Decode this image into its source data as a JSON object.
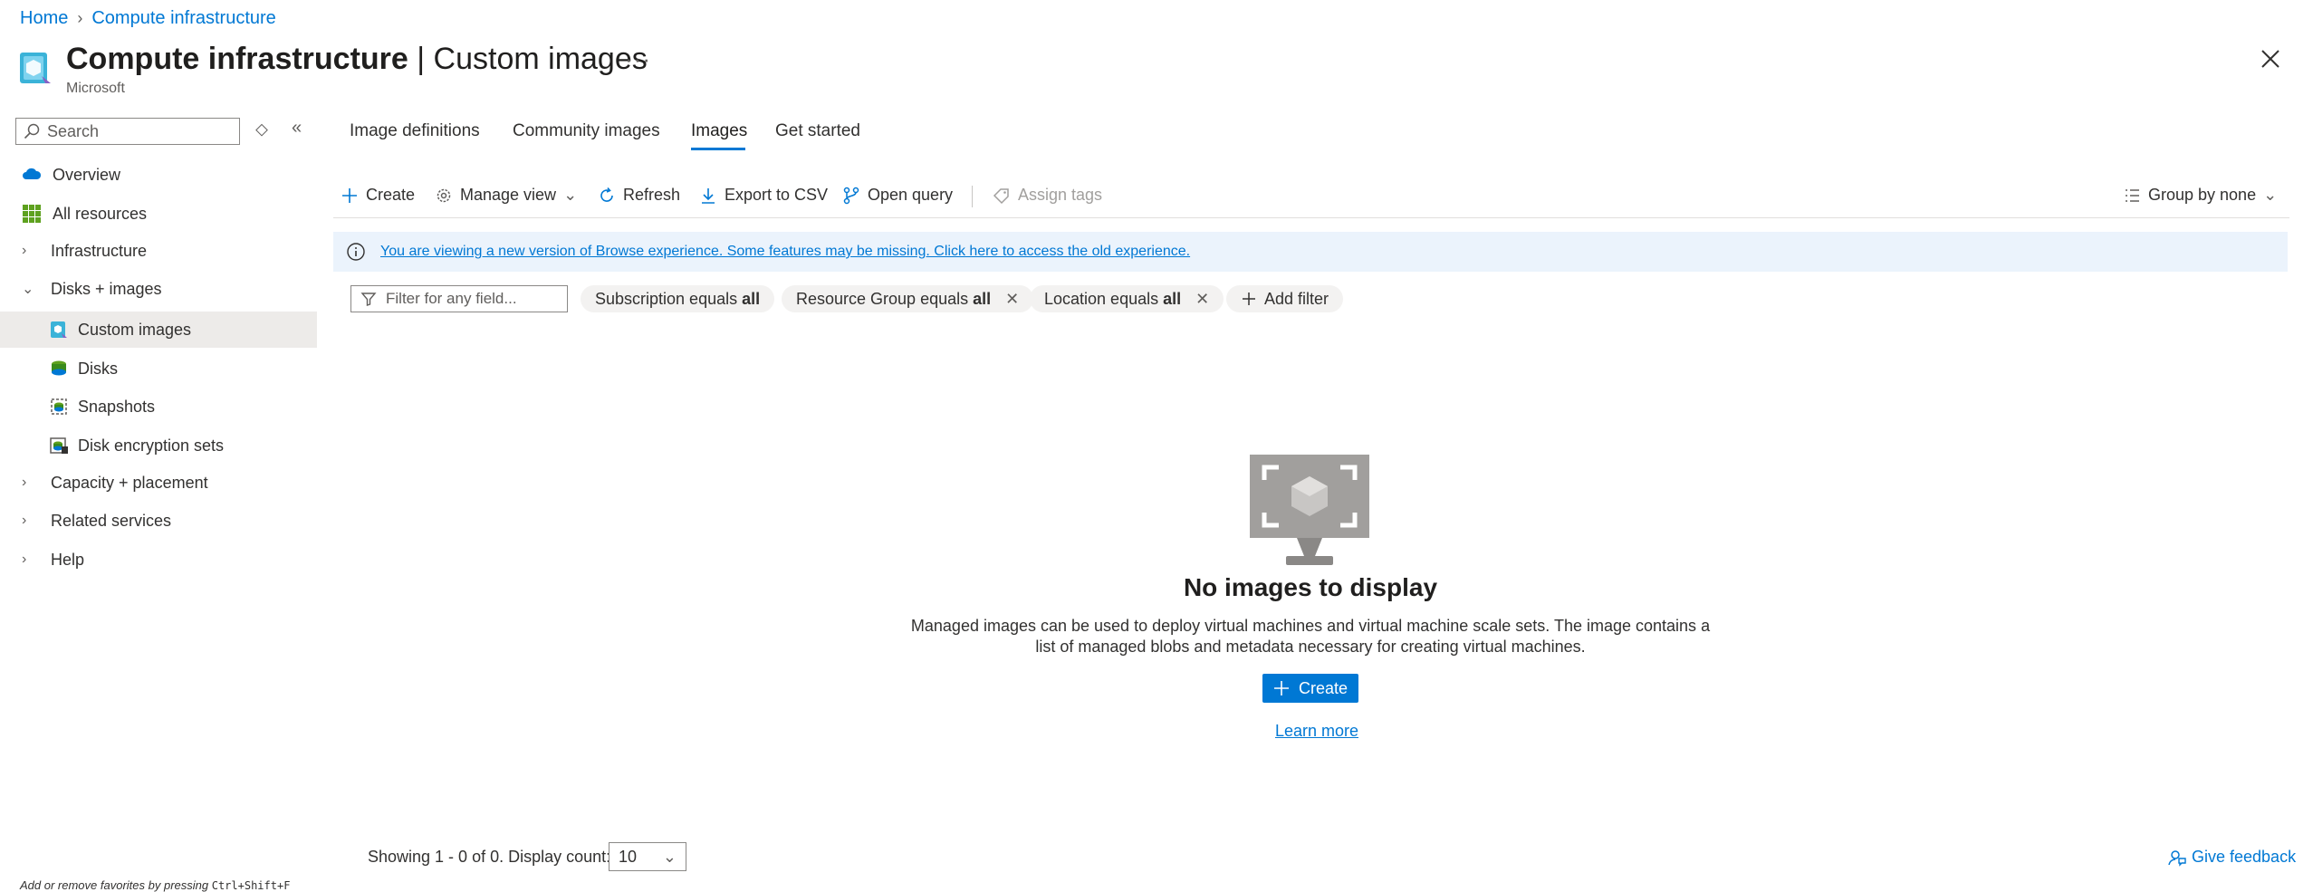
{
  "breadcrumb": {
    "home": "Home",
    "current": "Compute infrastructure"
  },
  "header": {
    "title_bold": "Compute infrastructure",
    "title_rest": " | Custom images",
    "subtitle": "Microsoft",
    "more": "···"
  },
  "sidebar": {
    "search_placeholder": "Search",
    "items": [
      {
        "label": "Overview"
      },
      {
        "label": "All resources"
      },
      {
        "label": "Infrastructure"
      },
      {
        "label": "Disks + images"
      },
      {
        "label": "Custom images"
      },
      {
        "label": "Disks"
      },
      {
        "label": "Snapshots"
      },
      {
        "label": "Disk encryption sets"
      },
      {
        "label": "Capacity + placement"
      },
      {
        "label": "Related services"
      },
      {
        "label": "Help"
      }
    ],
    "favorites_hint_prefix": "Add or remove favorites by pressing ",
    "favorites_hint_keys": "Ctrl+Shift+F"
  },
  "tabs": [
    {
      "label": "Image definitions"
    },
    {
      "label": "Community images"
    },
    {
      "label": "Images"
    },
    {
      "label": "Get started"
    }
  ],
  "toolbar": {
    "create": "Create",
    "manage_view": "Manage view",
    "refresh": "Refresh",
    "export_csv": "Export to CSV",
    "open_query": "Open query",
    "assign_tags": "Assign tags",
    "group_by": "Group by none"
  },
  "info_banner": "You are viewing a new version of Browse experience. Some features may be missing. Click here to access the old experience.",
  "filters": {
    "input_placeholder": "Filter for any field...",
    "pills": [
      {
        "prefix": "Subscription equals ",
        "value": "all"
      },
      {
        "prefix": "Resource Group equals ",
        "value": "all"
      },
      {
        "prefix": "Location equals ",
        "value": "all"
      }
    ],
    "add_filter": "Add filter"
  },
  "empty_state": {
    "title": "No images to display",
    "description": "Managed images can be used to deploy virtual machines and virtual machine scale sets. The image contains a list of managed blobs and metadata necessary for creating virtual machines.",
    "create": "Create",
    "learn_more": "Learn more"
  },
  "footer": {
    "showing": "Showing 1 - 0 of 0. Display count:",
    "display_count": "10",
    "feedback": "Give feedback"
  },
  "colors": {
    "accent": "#0078d4",
    "banner_bg": "#ebf3fc",
    "selected_nav": "#edebe9"
  }
}
